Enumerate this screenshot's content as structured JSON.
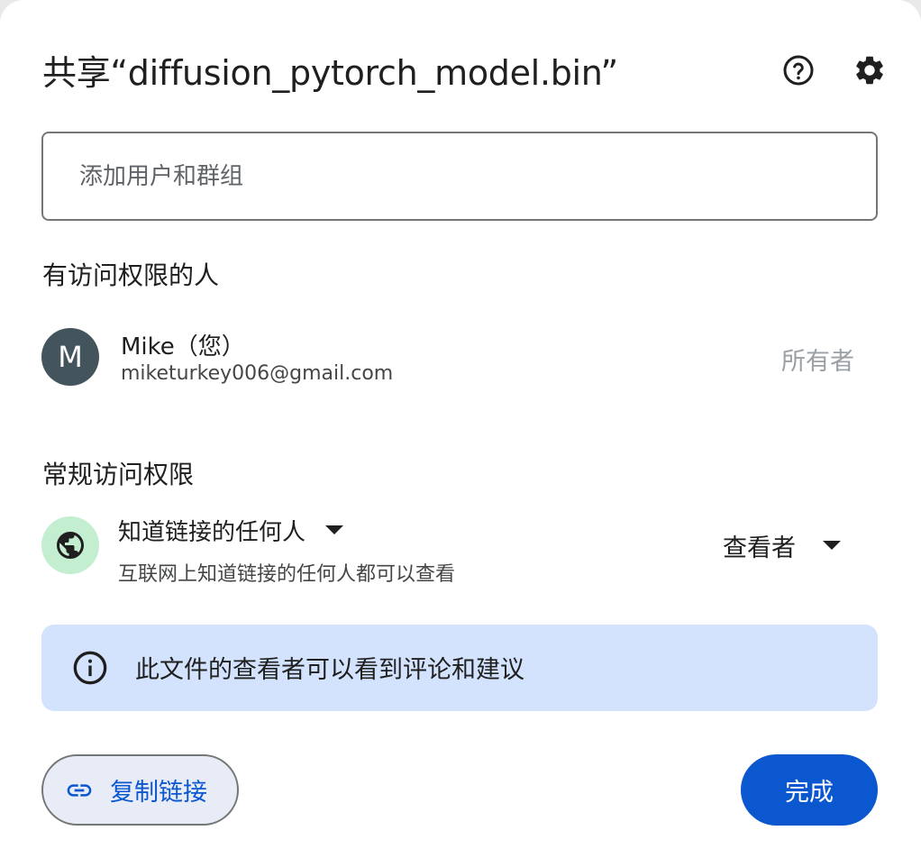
{
  "dialog": {
    "title": "共享“diffusion_pytorch_model.bin”",
    "help_icon": "help-circle-icon",
    "settings_icon": "gear-icon"
  },
  "add_people": {
    "placeholder": "添加用户和群组",
    "value": ""
  },
  "people_with_access": {
    "heading": "有访问权限的人",
    "people": [
      {
        "avatar_initial": "M",
        "avatar_color": "#44545d",
        "name": "Mike（您）",
        "email": "miketurkey006@gmail.com",
        "role": "所有者"
      }
    ]
  },
  "general_access": {
    "heading": "常规访问权限",
    "icon": "globe-icon",
    "icon_bg": "#c4eed0",
    "scope_label": "知道链接的任何人",
    "scope_description": "互联网上知道链接的任何人都可以查看",
    "role_label": "查看者"
  },
  "info_banner": {
    "icon": "info-icon",
    "text": "此文件的查看者可以看到评论和建议",
    "background": "#d3e3fd"
  },
  "footer": {
    "copy_link_label": "复制链接",
    "copy_link_icon": "link-icon",
    "done_label": "完成",
    "accent": "#0b57d0"
  }
}
